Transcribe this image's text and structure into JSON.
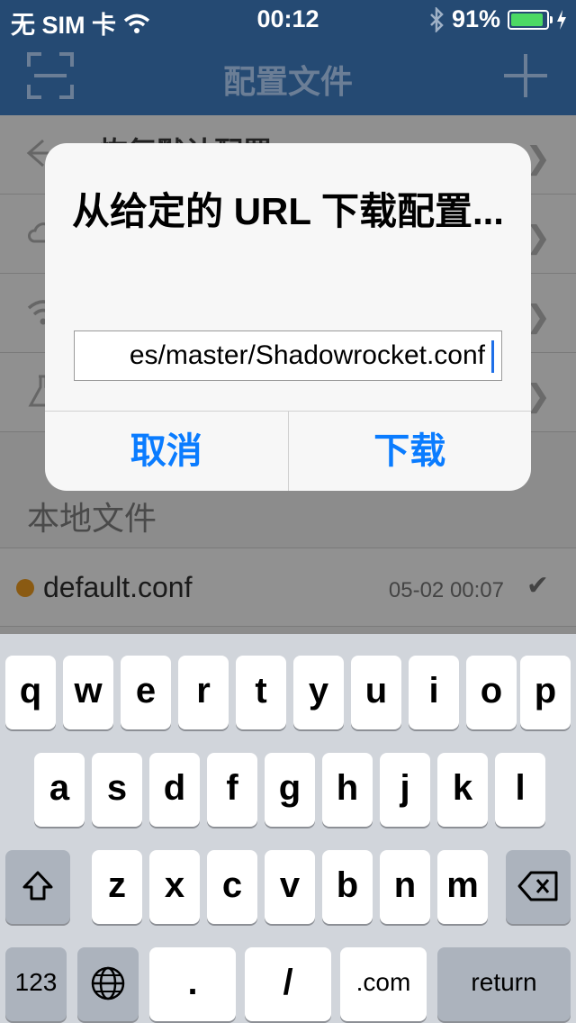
{
  "status_bar": {
    "carrier": "无 SIM 卡",
    "time": "00:12",
    "battery_percent": "91%",
    "battery_level": 0.91
  },
  "nav": {
    "title": "配置文件",
    "left_icon": "scan-icon",
    "right_icon": "plus-icon"
  },
  "list": {
    "rows": [
      {
        "label": "恢复默认配置",
        "icon": "back-icon"
      },
      {
        "label": "",
        "icon": "cloud-icon"
      },
      {
        "label": "",
        "icon": "wifi-icon"
      },
      {
        "label": "",
        "icon": "flask-icon"
      }
    ],
    "section_title": "本地文件",
    "files": [
      {
        "name": "default.conf",
        "time": "05-02 00:07",
        "selected": true,
        "dot_color": "#8a5a12"
      }
    ]
  },
  "dialog": {
    "title": "从给定的 URL 下载配置...",
    "input_value": "es/master/Shadowrocket.conf",
    "cancel_label": "取消",
    "confirm_label": "下载"
  },
  "keyboard": {
    "row1": [
      "q",
      "w",
      "e",
      "r",
      "t",
      "y",
      "u",
      "i",
      "o",
      "p"
    ],
    "row2": [
      "a",
      "s",
      "d",
      "f",
      "g",
      "h",
      "j",
      "k",
      "l"
    ],
    "row3": [
      "z",
      "x",
      "c",
      "v",
      "b",
      "n",
      "m"
    ],
    "numbers_label": "123",
    "dot_label": ".",
    "slash_label": "/",
    "dotcom_label": ".com",
    "return_label": "return"
  }
}
